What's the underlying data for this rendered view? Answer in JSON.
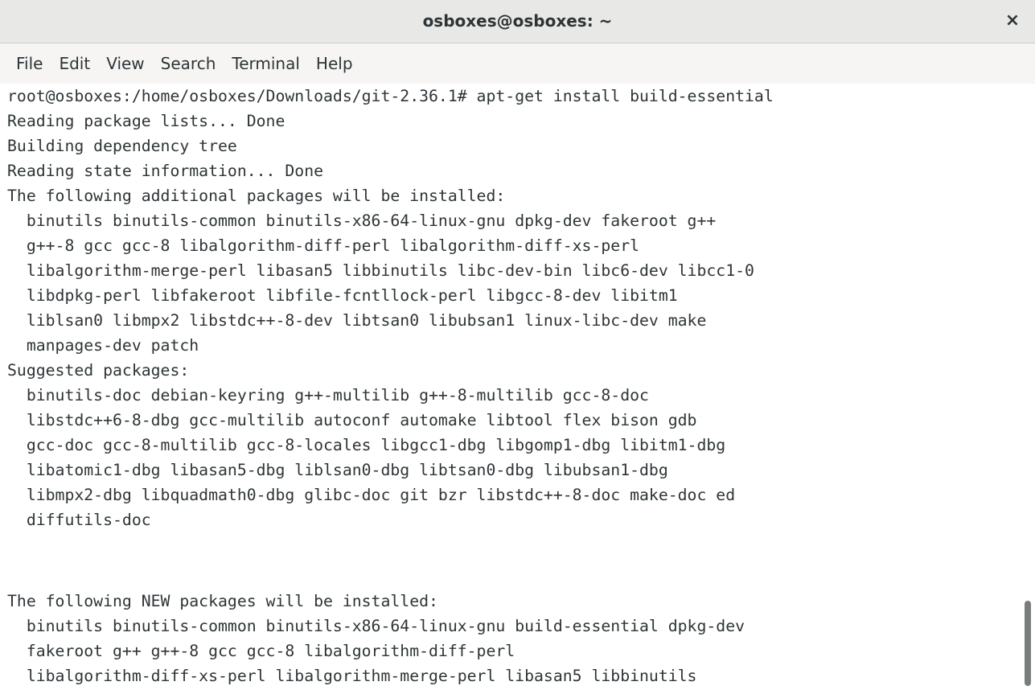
{
  "window": {
    "title": "osboxes@osboxes: ~",
    "close_label": "×"
  },
  "menu": [
    "File",
    "Edit",
    "View",
    "Search",
    "Terminal",
    "Help"
  ],
  "terminal": {
    "lines": [
      "root@osboxes:/home/osboxes/Downloads/git-2.36.1# apt-get install build-essential",
      "Reading package lists... Done",
      "Building dependency tree",
      "Reading state information... Done",
      "The following additional packages will be installed:",
      "  binutils binutils-common binutils-x86-64-linux-gnu dpkg-dev fakeroot g++",
      "  g++-8 gcc gcc-8 libalgorithm-diff-perl libalgorithm-diff-xs-perl",
      "  libalgorithm-merge-perl libasan5 libbinutils libc-dev-bin libc6-dev libcc1-0",
      "  libdpkg-perl libfakeroot libfile-fcntllock-perl libgcc-8-dev libitm1",
      "  liblsan0 libmpx2 libstdc++-8-dev libtsan0 libubsan1 linux-libc-dev make",
      "  manpages-dev patch",
      "Suggested packages:",
      "  binutils-doc debian-keyring g++-multilib g++-8-multilib gcc-8-doc",
      "  libstdc++6-8-dbg gcc-multilib autoconf automake libtool flex bison gdb",
      "  gcc-doc gcc-8-multilib gcc-8-locales libgcc1-dbg libgomp1-dbg libitm1-dbg",
      "  libatomic1-dbg libasan5-dbg liblsan0-dbg libtsan0-dbg libubsan1-dbg",
      "  libmpx2-dbg libquadmath0-dbg glibc-doc git bzr libstdc++-8-doc make-doc ed",
      "  diffutils-doc",
      "",
      "",
      "The following NEW packages will be installed:",
      "  binutils binutils-common binutils-x86-64-linux-gnu build-essential dpkg-dev",
      "  fakeroot g++ g++-8 gcc gcc-8 libalgorithm-diff-perl",
      "  libalgorithm-diff-xs-perl libalgorithm-merge-perl libasan5 libbinutils"
    ]
  },
  "colors": {
    "titlebar": "#e8e8e7",
    "menubar": "#f6f5f4",
    "terminal_bg": "#ffffff",
    "text": "#2e3436",
    "scroll_thumb": "#7a7d7e"
  }
}
